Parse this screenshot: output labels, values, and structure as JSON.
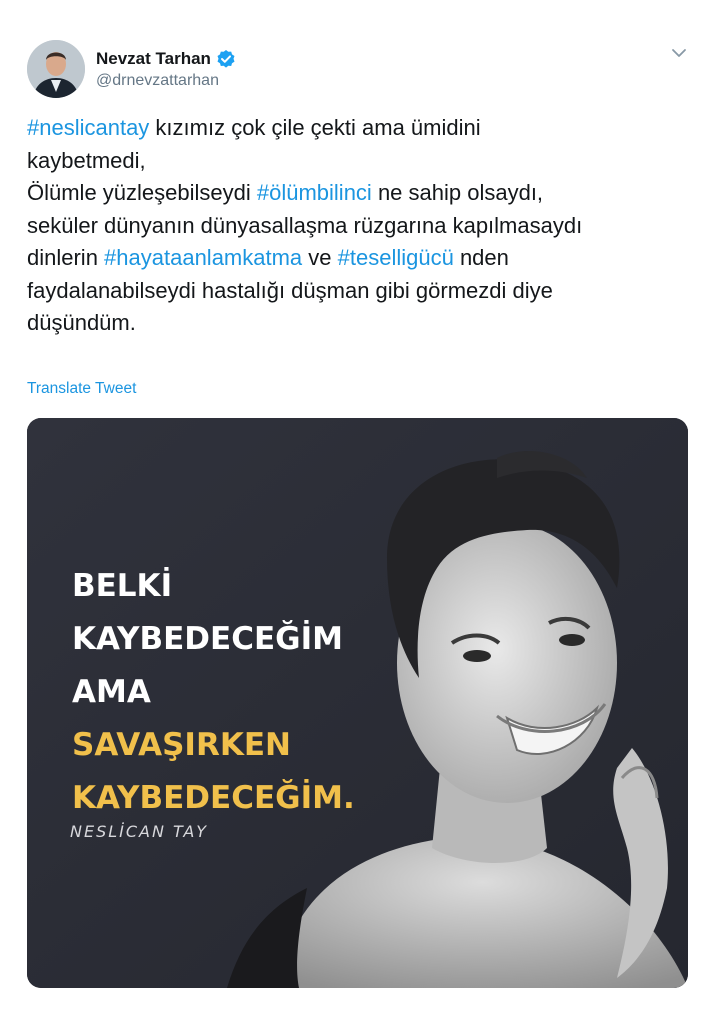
{
  "author": {
    "display_name": "Nevzat Tarhan",
    "handle": "@drnevzattarhan",
    "verified": true,
    "avatar_icon": "avatar-photo-icon"
  },
  "menu": {
    "icon": "chevron-down-icon"
  },
  "tweet": {
    "lines": [
      [
        {
          "t": "#neslicantay",
          "tag": true
        },
        {
          "t": " kızımız çok çile çekti ama ümidini",
          "tag": false
        }
      ],
      [
        {
          "t": "kaybetmedi,",
          "tag": false
        }
      ],
      [
        {
          "t": "Ölümle yüzleşebilseydi ",
          "tag": false
        },
        {
          "t": "#ölümbilinci",
          "tag": true
        },
        {
          "t": " ne sahip olsaydı,",
          "tag": false
        }
      ],
      [
        {
          "t": "seküler dünyanın dünyasallaşma rüzgarına kapılmasaydı",
          "tag": false
        }
      ],
      [
        {
          "t": "dinlerin ",
          "tag": false
        },
        {
          "t": "#hayataanlamkatma",
          "tag": true
        },
        {
          "t": " ve ",
          "tag": false
        },
        {
          "t": "#teselligücü",
          "tag": true
        },
        {
          "t": " nden",
          "tag": false
        }
      ],
      [
        {
          "t": "faydalanabilseydi hastalığı düşman gibi görmezdi diye",
          "tag": false
        }
      ],
      [
        {
          "t": "düşündüm.",
          "tag": false
        }
      ]
    ],
    "translate_label": "Translate Tweet"
  },
  "media": {
    "quote_white_1": "BELKİ",
    "quote_white_2": "KAYBEDECEĞİM",
    "quote_white_3": "AMA",
    "quote_yellow_1": "SAVAŞIRKEN",
    "quote_yellow_2": "KAYBEDECEĞİM.",
    "signature": "NESLİCAN TAY",
    "colors": {
      "background": "#2d2f38",
      "quote_white": "#ffffff",
      "quote_yellow": "#f1c04b"
    }
  },
  "colors": {
    "link": "#1b95e0",
    "text": "#14171a",
    "muted": "#657786",
    "verified": "#1da1f2"
  }
}
